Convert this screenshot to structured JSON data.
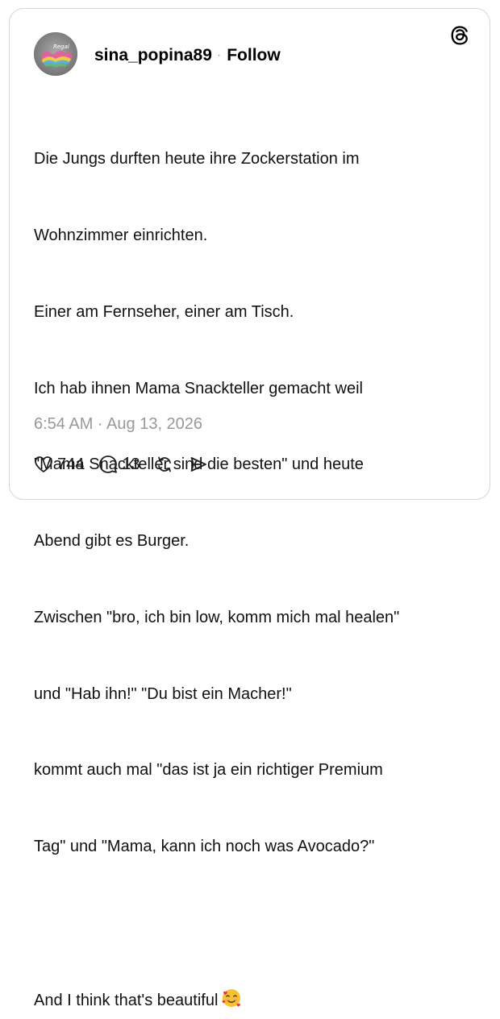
{
  "post": {
    "username": "sina_popina89",
    "separator": "·",
    "follow_label": "Follow",
    "avatar_text": "Regal",
    "lines": [
      "Die Jungs durften heute ihre Zockerstation im",
      "Wohnzimmer einrichten.",
      "Einer am Fernseher, einer am Tisch.",
      "Ich hab ihnen Mama Snackteller gemacht weil",
      "\"Mama Snackteller sind die besten\" und heute",
      "Abend gibt es Burger.",
      "Zwischen \"bro, ich bin low, komm mich mal healen\"",
      "und \"Hab ihn!\" \"Du bist ein Macher!\"",
      "kommt auch mal \"das ist ja ein richtiger Premium",
      "Tag\" und \"Mama, kann ich noch was Avocado?\"",
      "",
      "And I think that's beautiful"
    ],
    "timestamp": "6:54 AM · Aug 13, 2026",
    "likes": "744",
    "replies": "13"
  },
  "icons": {
    "logo": "threads-logo-icon",
    "emoji": "smiling-face-with-hearts-icon",
    "like": "heart-icon",
    "reply": "comment-icon",
    "repost": "repost-icon",
    "share": "send-icon"
  },
  "colors": {
    "text": "#111111",
    "muted": "#999999",
    "border": "#d6d6d6",
    "emoji_face": "#f7c230",
    "emoji_heart": "#e8344a"
  }
}
